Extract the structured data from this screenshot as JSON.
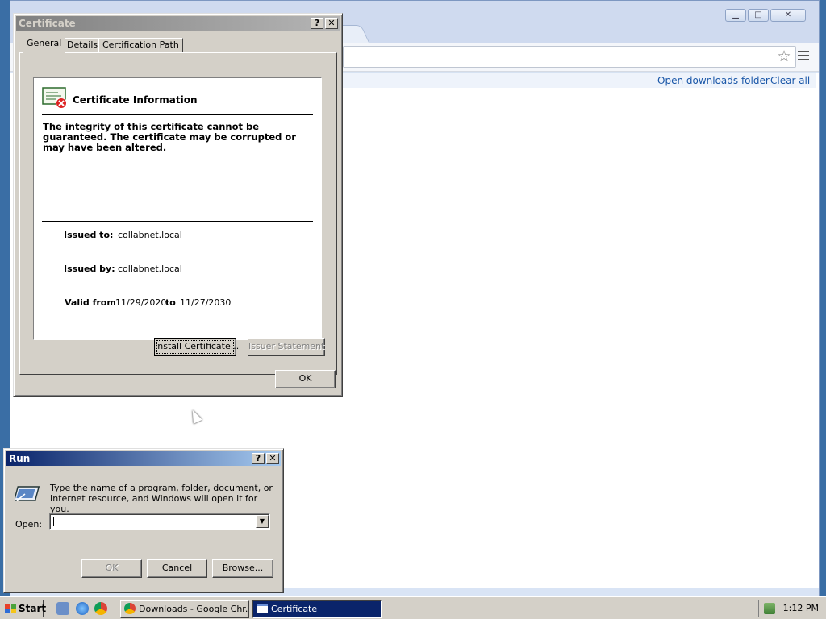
{
  "browser": {
    "window_controls": {
      "minimize": "▁",
      "maximize": "□",
      "close": "✕"
    },
    "toolbar": {
      "star_icon": "star-icon",
      "menu_icon": "menu-icon"
    },
    "downloads": {
      "open_folder": "Open downloads folder",
      "clear_all": "Clear all"
    }
  },
  "certificate_dialog": {
    "title": "Certificate",
    "title_buttons": {
      "help": "?",
      "close": "✕"
    },
    "tabs": [
      {
        "label": "General",
        "selected": true
      },
      {
        "label": "Details",
        "selected": false
      },
      {
        "label": "Certification Path",
        "selected": false
      }
    ],
    "info_title": "Certificate Information",
    "warning": "The integrity of this certificate cannot be guaranteed. The certificate may be corrupted or may have been altered.",
    "issued_to_label": "Issued to:",
    "issued_to": "collabnet.local",
    "issued_by_label": "Issued by:",
    "issued_by": "collabnet.local",
    "valid_from_label": "Valid from",
    "valid_from": "11/29/2020",
    "to_label": "to",
    "valid_to": "11/27/2030",
    "buttons": {
      "install": "Install Certificate...",
      "issuer_statement": "Issuer Statement",
      "ok": "OK"
    }
  },
  "run_dialog": {
    "title": "Run",
    "title_buttons": {
      "help": "?",
      "close": "✕"
    },
    "description": "Type the name of a program, folder, document, or Internet resource, and Windows will open it for you.",
    "open_label": "Open:",
    "open_value": "",
    "buttons": {
      "ok": "OK",
      "cancel": "Cancel",
      "browse": "Browse..."
    }
  },
  "taskbar": {
    "start_label": "Start",
    "tasks": [
      {
        "label": "Downloads - Google Chr...",
        "active": false
      },
      {
        "label": "Certificate",
        "active": true
      }
    ],
    "clock": "1:12 PM"
  }
}
